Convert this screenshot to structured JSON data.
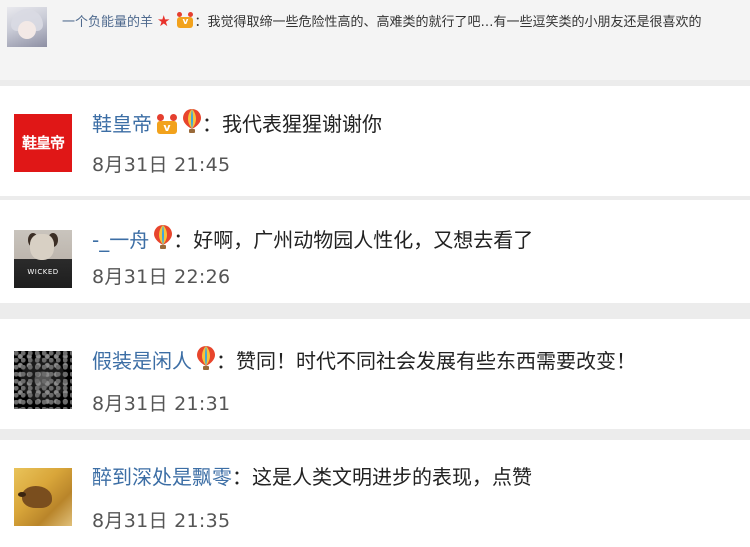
{
  "quoted": {
    "username": "一个负能量的羊",
    "content": "：我觉得取缔一些危险性高的、高难类的就行了吧…有一些逗笑类的小朋友还是很喜欢的"
  },
  "comments": [
    {
      "username": "鞋皇帝",
      "text": "：我代表猩猩谢谢你",
      "time": "8月31日 21:45",
      "avatar_text": "鞋皇帝",
      "badges": [
        "vip-crown-icon",
        "balloon-icon"
      ]
    },
    {
      "username": "-_一舟",
      "text": "：好啊，广州动物园人性化，又想去看了",
      "time": "8月31日 22:26",
      "avatar_text": "WICKED",
      "badges": [
        "balloon-icon"
      ]
    },
    {
      "username": "假装是闲人",
      "text": "：赞同！时代不同社会发展有些东西需要改变！",
      "time": "8月31日 21:31",
      "badges": [
        "balloon-icon"
      ]
    },
    {
      "username": "醉到深处是飘零",
      "text": "：这是人类文明进步的表现，点赞",
      "time": "8月31日 21:35",
      "badges": []
    }
  ],
  "colors": {
    "username": "#3c6ea5",
    "background": "#ffffff",
    "quote_background": "#f4f4f4",
    "star": "#e8322b"
  }
}
